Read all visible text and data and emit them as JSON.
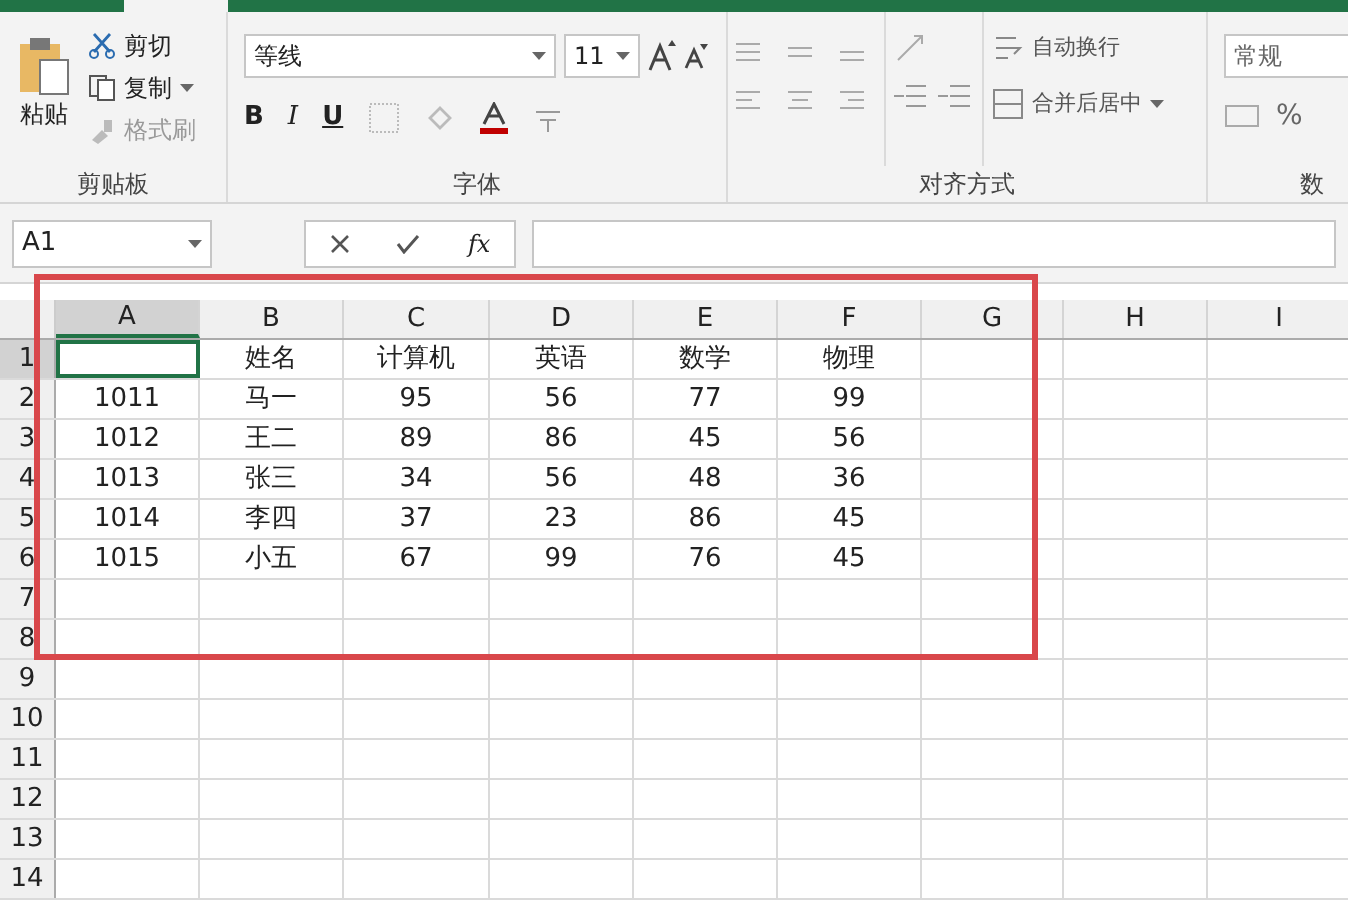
{
  "ribbon": {
    "clipboard": {
      "paste": "粘贴",
      "cut": "剪切",
      "copy": "复制",
      "format_painter": "格式刷",
      "label": "剪贴板"
    },
    "font": {
      "name": "等线",
      "size": "11",
      "bold": "B",
      "italic": "I",
      "underline": "U",
      "label": "字体"
    },
    "alignment": {
      "wrap": "自动换行",
      "merge": "合并后居中",
      "label": "对齐方式"
    },
    "number": {
      "format": "常规",
      "percent": "%",
      "label": "数"
    }
  },
  "formula_bar": {
    "name_box": "A1",
    "function_label": "fx"
  },
  "grid": {
    "columns": [
      {
        "label": "A",
        "selected": true
      },
      {
        "label": "B",
        "selected": false
      },
      {
        "label": "C",
        "selected": false
      },
      {
        "label": "D",
        "selected": false
      },
      {
        "label": "E",
        "selected": false
      },
      {
        "label": "F",
        "selected": false
      },
      {
        "label": "G",
        "selected": false
      },
      {
        "label": "H",
        "selected": false
      },
      {
        "label": "I",
        "selected": false
      }
    ],
    "rows": [
      {
        "number": "1",
        "selected": true,
        "cells": [
          null,
          "姓名",
          "计算机",
          "英语",
          "数学",
          "物理"
        ]
      },
      {
        "number": "2",
        "selected": false,
        "cells": [
          "1011",
          "马一",
          "95",
          "56",
          "77",
          "99"
        ]
      },
      {
        "number": "3",
        "selected": false,
        "cells": [
          "1012",
          "王二",
          "89",
          "86",
          "45",
          "56"
        ]
      },
      {
        "number": "4",
        "selected": false,
        "cells": [
          "1013",
          "张三",
          "34",
          "56",
          "48",
          "36"
        ]
      },
      {
        "number": "5",
        "selected": false,
        "cells": [
          "1014",
          "李四",
          "37",
          "23",
          "86",
          "45"
        ]
      },
      {
        "number": "6",
        "selected": false,
        "cells": [
          "1015",
          "小五",
          "67",
          "99",
          "76",
          "45"
        ]
      },
      {
        "number": "7",
        "selected": false
      },
      {
        "number": "8",
        "selected": false
      },
      {
        "number": "9",
        "selected": false
      },
      {
        "number": "10",
        "selected": false
      },
      {
        "number": "11",
        "selected": false
      },
      {
        "number": "12",
        "selected": false
      },
      {
        "number": "13",
        "selected": false
      },
      {
        "number": "14",
        "selected": false
      }
    ]
  }
}
